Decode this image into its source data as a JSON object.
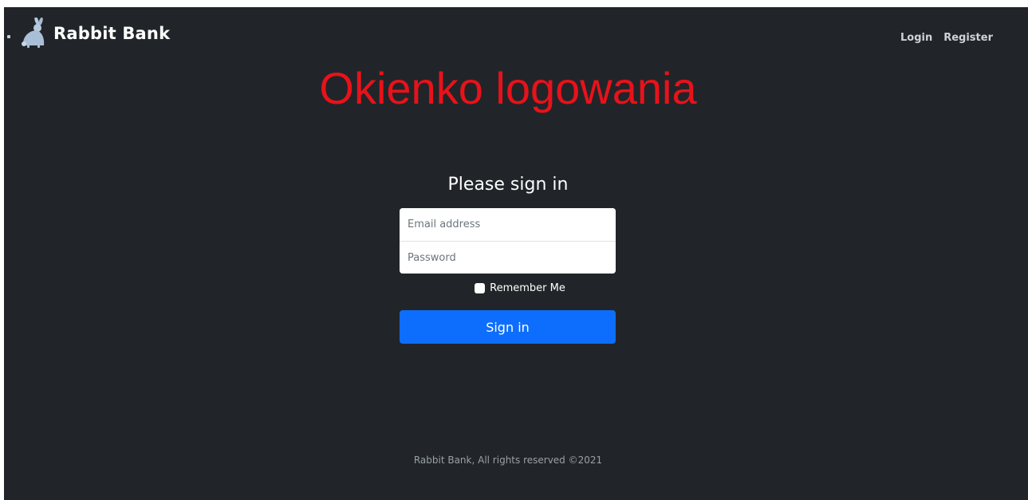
{
  "navbar": {
    "brand_name": "Rabbit Bank",
    "logo_icon": "rabbit-icon",
    "links": [
      {
        "label": "Login"
      },
      {
        "label": "Register"
      }
    ]
  },
  "headline": "Okienko logowania",
  "form": {
    "title": "Please sign in",
    "email_placeholder": "Email address",
    "password_placeholder": "Password",
    "remember_label": "Remember Me",
    "submit_label": "Sign in"
  },
  "footer": {
    "text": "Rabbit Bank, All rights reserved ©2021"
  },
  "colors": {
    "background": "#212529",
    "headline": "#e8121a",
    "primary": "#0d6efd"
  }
}
